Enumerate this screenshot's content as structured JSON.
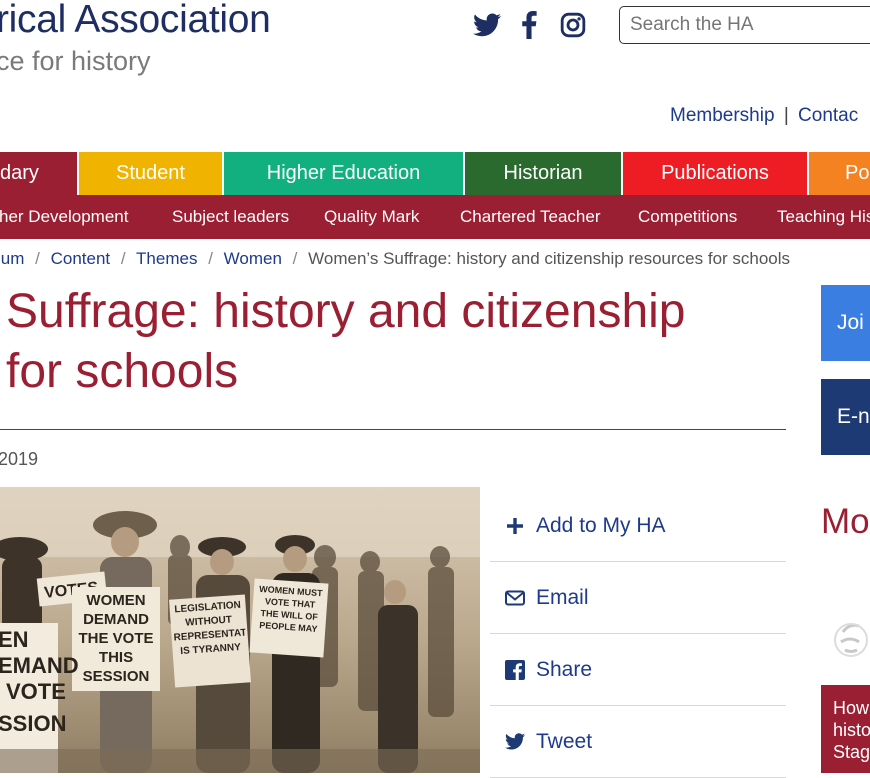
{
  "header": {
    "logo_title": "rical Association",
    "logo_tagline": "ce for history",
    "social": [
      {
        "icon": "twitter-icon"
      },
      {
        "icon": "facebook-icon"
      },
      {
        "icon": "instagram-icon"
      }
    ],
    "search": {
      "placeholder": "Search the HA",
      "value": ""
    },
    "top_links": {
      "membership": "Membership",
      "separator": "|",
      "contact": "Contac"
    }
  },
  "colors": {
    "brand_navy": "#1e2e63",
    "brand_maroon": "#9a1f33",
    "link_blue": "#1e3a8c",
    "join_blue": "#3b7ee1",
    "enews_navy": "#1e3a74"
  },
  "main_nav": [
    {
      "label": "dary",
      "color": "#9a1f33"
    },
    {
      "label": "Student",
      "color": "#f0b400"
    },
    {
      "label": "Higher Education",
      "color": "#12b07f"
    },
    {
      "label": "Historian",
      "color": "#2b6a2f"
    },
    {
      "label": "Publications",
      "color": "#ee1d23"
    },
    {
      "label": "Po",
      "color": "#f58220"
    }
  ],
  "sub_nav": [
    "her Development",
    "Subject leaders",
    "Quality Mark",
    "Chartered Teacher",
    "Competitions",
    "Teaching His"
  ],
  "breadcrumb": {
    "items": [
      "lum",
      "Content",
      "Themes",
      "Women"
    ],
    "separator": "/",
    "current": "Women’s Suffrage: history and citizenship resources for schools"
  },
  "article": {
    "title_line1": "Suffrage: history and citizenship",
    "title_line2": "for schools",
    "date": "2019",
    "photo_text": {
      "sign_1": "VOTES",
      "sign_2": "WOMEN DEMAND THE VOTE THIS SESSION",
      "sign_3": "LEGISLATION WITHOUT REPRESENTATION IS TYRANNY",
      "sign_4": "WOMEN MUST VOTE THAT THE WILL OF PEOPLE MAY",
      "sign_5_line1": "EN",
      "sign_5_line2": "EMAND",
      "sign_5_line3": "VOTE",
      "sign_5_line4": "SSION"
    }
  },
  "actions": [
    {
      "icon": "plus-icon",
      "label": "Add to My HA"
    },
    {
      "icon": "envelope-icon",
      "label": "Email"
    },
    {
      "icon": "facebook-icon",
      "label": "Share"
    },
    {
      "icon": "twitter-icon",
      "label": "Tweet"
    }
  ],
  "sidebar": {
    "join_label": "Joi",
    "enews_label": "E-n",
    "more_heading": "Mo",
    "card_text": "How histo Stag"
  }
}
